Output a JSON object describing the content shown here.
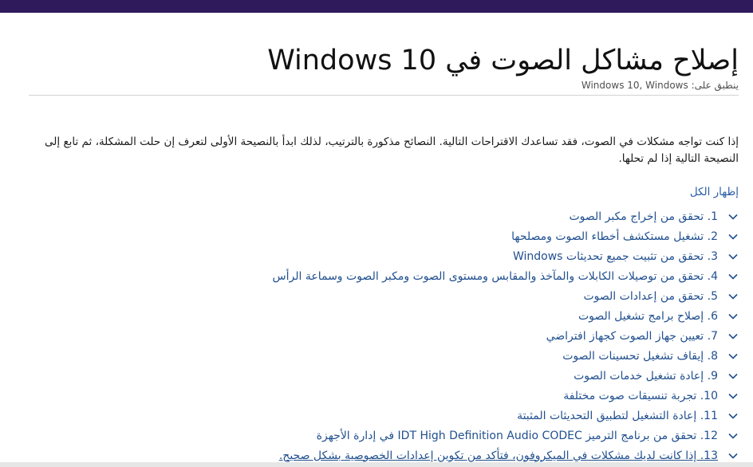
{
  "header": {
    "title": "إصلاح مشاكل الصوت في Windows 10",
    "applies_to_label": "ينطبق على:",
    "applies_to_value": "Windows 10, Windows"
  },
  "intro": "إذا كنت تواجه مشكلات في الصوت، فقد تساعدك الاقتراحات التالية. النصائح مذكورة بالترتيب، لذلك ابدأ بالنصيحة الأولى لتعرف إن حلت المشكلة، ثم تابع إلى النصيحة التالية إذا لم تحلها.",
  "expand_all": "إظهار الكل",
  "items": [
    {
      "label": "1. تحقق من إخراج مكبر الصوت"
    },
    {
      "label": "2. تشغيل مستكشف أخطاء الصوت ومصلحها"
    },
    {
      "label": "3. تحقق من تثبيت جميع تحديثات Windows"
    },
    {
      "label": "4. تحقق من توصيلات الكابلات والمآخذ والمقابس ومستوى الصوت ومكبر الصوت وسماعة الرأس"
    },
    {
      "label": "5. تحقق من إعدادات الصوت"
    },
    {
      "label": "6. إصلاح برامج تشغيل الصوت"
    },
    {
      "label": "7. تعيين جهاز الصوت كجهاز افتراضي"
    },
    {
      "label": "8. إيقاف تشغيل تحسينات الصوت"
    },
    {
      "label": "9. إعادة تشغيل خدمات الصوت"
    },
    {
      "label": "10. تجربة تنسيقات صوت مختلفة"
    },
    {
      "label": "11. إعادة التشغيل لتطبيق التحديثات المثبتة"
    },
    {
      "label": "12. تحقق من برنامج الترميز IDT High Definition Audio CODEC في إدارة الأجهزة"
    },
    {
      "label": "13. إذا كانت لديك مشكلات في الميكروفون، فتأكد من تكوين إعدادات الخصوصية بشكل صحيح."
    }
  ],
  "colors": {
    "top_bar": "#2f1a5c",
    "link": "#21508f"
  },
  "icons": {
    "item_expand": "chevron-down-icon"
  }
}
